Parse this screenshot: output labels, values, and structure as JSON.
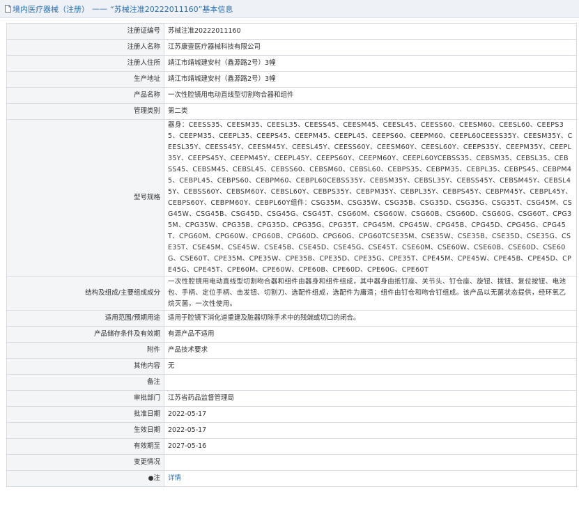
{
  "breadcrumb": {
    "part1": "境内医疗器械（注册）",
    "separator": "——",
    "part2": "“苏械注准20222011160”",
    "part3": "基本信息"
  },
  "rows": [
    {
      "label": "注册证编号",
      "value": "苏械注准20222011160"
    },
    {
      "label": "注册人名称",
      "value": "江苏康壹医疗器械科技有限公司"
    },
    {
      "label": "注册人住所",
      "value": "靖江市靖城建安村（鑫源路2号）3幢"
    },
    {
      "label": "生产地址",
      "value": "靖江市靖城建安村（鑫源路2号）3幢"
    },
    {
      "label": "产品名称",
      "value": "一次性腔镜用电动直线型切割吻合器和组件"
    },
    {
      "label": "管理类别",
      "value": "第二类"
    },
    {
      "label": "型号规格",
      "value": "器身：CEESS35、CEESM35、CEESL35、CEESS45、CEESM45、CEESL45、CEESS60、CEESM60、CEESL60、CEEPS35、CEEPM35、CEEPL35、CEEPS45、CEEPM45、CEEPL45、CEEPS60、CEEPM60、CEEPL60CEESS35Y、CEESM35Y、CEESL35Y、CEESS45Y、CEESM45Y、CEESL45Y、CEESS60Y、CEESM60Y、CEESL60Y、CEEPS35Y、CEEPM35Y、CEEPL35Y、CEEPS45Y、CEEPM45Y、CEEPL45Y、CEEPS60Y、CEEPM60Y、CEEPL60YCEBSS35、CEBSM35、CEBSL35、CEBSS45、CEBSM45、CEBSL45、CEBSS60、CEBSM60、CEBSL60、CEBPS35、CEBPM35、CEBPL35、CEBPS45、CEBPM45、CEBPL45、CEBPS60、CEBPM60、CEBPL60CEBSS35Y、CEBSM35Y、CEBSL35Y、CEBSS45Y、CEBSM45Y、CEBSL45Y、CEBSS60Y、CEBSM60Y、CEBSL60Y、CEBPS35Y、CEBPM35Y、CEBPL35Y、CEBPS45Y、CEBPM45Y、CEBPL45Y、CEBPS60Y、CEBPM60Y、CEBPL60Y组件：CSG35M、CSG35W、CSG35B、CSG35D、CSG35G、CSG35T、CSG45M、CSG45W、CSG45B、CSG45D、CSG45G、CSG45T、CSG60M、CSG60W、CSG60B、CSG60D、CSG60G、CSG60T、CPG35M、CPG35W、CPG35B、CPG35D、CPG35G、CPG35T、CPG45M、CPG45W、CPG45B、CPG45D、CPG45G、CPG45T、CPG60M、CPG60W、CPG60B、CPG60D、CPG60G、CPG60TCSE35M、CSE35W、CSE35B、CSE35D、CSE35G、CSE35T、CSE45M、CSE45W、CSE45B、CSE45D、CSE45G、CSE45T、CSE60M、CSE60W、CSE60B、CSE60D、CSE60G、CSE60T、CPE35M、CPE35W、CPE35B、CPE35D、CPE35G、CPE35T、CPE45M、CPE45W、CPE45B、CPE45D、CPE45G、CPE45T、CPE60M、CPE60W、CPE60B、CPE60D、CPE60G、CPE60T"
    },
    {
      "label": "结构及组成/主要组成成分",
      "value": "一次性腔镜用电动直线型切割吻合器和组件由器身和组件组成，其中器身由抵钉座、关节头、钉仓座、旋钮、拨钮、复位按钮、电池包、手柄、定位手柄、击发钮、切割刀、选配件组成，选配件为庸滴；组件由钉仓和吻合钉组成。该产品以无菌状态提供，经环氧乙烷灭菌，一次性使用。"
    },
    {
      "label": "适用范围/预期用途",
      "value": "适用于腔镜下消化道重建及脏器切除手术中的残端或切口的闭合。"
    },
    {
      "label": "产品储存条件及有效期",
      "value": "有源产品不适用"
    },
    {
      "label": "附件",
      "value": "产品技术要求"
    },
    {
      "label": "其他内容",
      "value": "无"
    },
    {
      "label": "备注",
      "value": ""
    },
    {
      "label": "审批部门",
      "value": "江苏省药品监督管理局"
    },
    {
      "label": "批准日期",
      "value": "2022-05-17"
    },
    {
      "label": "生效日期",
      "value": "2022-05-17"
    },
    {
      "label": "有效期至",
      "value": "2027-05-16"
    },
    {
      "label": "变更情况",
      "value": ""
    }
  ],
  "note_row": {
    "label": "注",
    "link": "详情"
  }
}
